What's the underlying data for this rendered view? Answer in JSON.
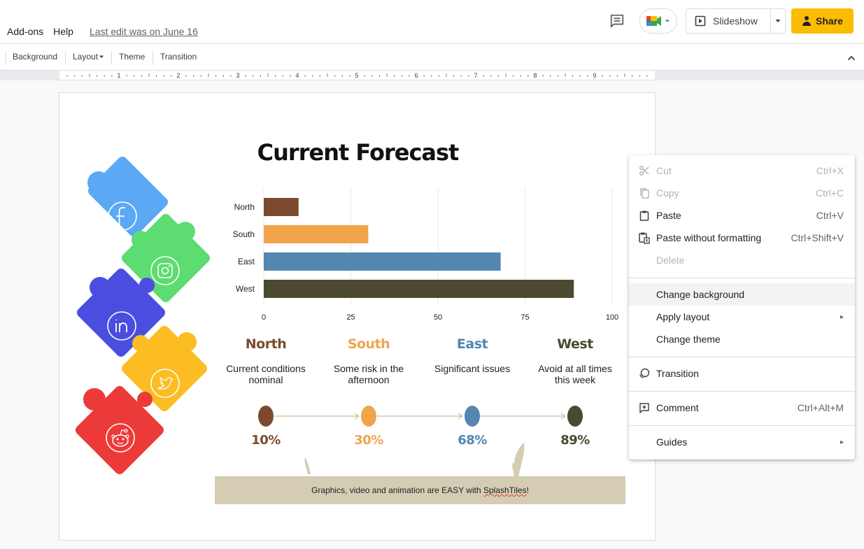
{
  "menu": {
    "addons": "Add-ons",
    "help": "Help",
    "last_edit": "Last edit was on June 16"
  },
  "header": {
    "slideshow_label": "Slideshow",
    "share_label": "Share"
  },
  "toolbar": {
    "background": "Background",
    "layout": "Layout",
    "theme": "Theme",
    "transition": "Transition"
  },
  "ruler": {
    "numbers": [
      "1",
      "2",
      "3",
      "4",
      "5",
      "6",
      "7",
      "8",
      "9"
    ]
  },
  "slide": {
    "title": "Current Forecast",
    "regions": [
      {
        "name": "North",
        "desc_line1": "Current conditions",
        "desc_line2": "nominal",
        "pct": "10%",
        "color": "#7b4a2d"
      },
      {
        "name": "South",
        "desc_line1": "Some risk in the",
        "desc_line2": "afternoon",
        "pct": "30%",
        "color": "#f0a44b"
      },
      {
        "name": "East",
        "desc_line1": "Significant issues",
        "desc_line2": "",
        "pct": "68%",
        "color": "#5386b0"
      },
      {
        "name": "West",
        "desc_line1": "Avoid at all times",
        "desc_line2": "this week",
        "pct": "89%",
        "color": "#4b4a30"
      }
    ],
    "banner_prefix": "Graphics, video and animation are EASY with ",
    "banner_brand": "SplashTiles",
    "banner_suffix": "!",
    "puzzle_icons": [
      {
        "icon": "facebook-icon",
        "color": "#5ba8f5"
      },
      {
        "icon": "instagram-icon",
        "color": "#5ddc72"
      },
      {
        "icon": "linkedin-icon",
        "color": "#4a4ee0"
      },
      {
        "icon": "twitter-icon",
        "color": "#fbbd22"
      },
      {
        "icon": "reddit-icon",
        "color": "#ec3a38"
      }
    ]
  },
  "chart_data": {
    "type": "bar",
    "orientation": "horizontal",
    "categories": [
      "North",
      "South",
      "East",
      "West"
    ],
    "values": [
      10,
      30,
      68,
      89
    ],
    "colors": [
      "#7b4a2d",
      "#f0a44b",
      "#5386b0",
      "#4b4a30"
    ],
    "xlim": [
      0,
      100
    ],
    "xticks": [
      "0",
      "25",
      "50",
      "75",
      "100"
    ],
    "grid": true
  },
  "context_menu": {
    "items": [
      {
        "label": "Cut",
        "shortcut": "Ctrl+X",
        "disabled": true,
        "icon": "scissors-icon"
      },
      {
        "label": "Copy",
        "shortcut": "Ctrl+C",
        "disabled": true,
        "icon": "copy-icon"
      },
      {
        "label": "Paste",
        "shortcut": "Ctrl+V",
        "disabled": false,
        "icon": "paste-icon"
      },
      {
        "label": "Paste without formatting",
        "shortcut": "Ctrl+Shift+V",
        "disabled": false,
        "icon": "paste-plain-icon"
      },
      {
        "label": "Delete",
        "shortcut": "",
        "disabled": true,
        "icon": ""
      },
      {
        "label": "Change background",
        "shortcut": "",
        "disabled": false,
        "icon": ""
      },
      {
        "label": "Apply layout",
        "shortcut": "",
        "disabled": false,
        "icon": ""
      },
      {
        "label": "Change theme",
        "shortcut": "",
        "disabled": false,
        "icon": ""
      },
      {
        "label": "Transition",
        "shortcut": "",
        "disabled": false,
        "icon": "transition-icon"
      },
      {
        "label": "Comment",
        "shortcut": "Ctrl+Alt+M",
        "disabled": false,
        "icon": "add-comment-icon"
      },
      {
        "label": "Guides",
        "shortcut": "",
        "disabled": false,
        "icon": ""
      }
    ]
  }
}
